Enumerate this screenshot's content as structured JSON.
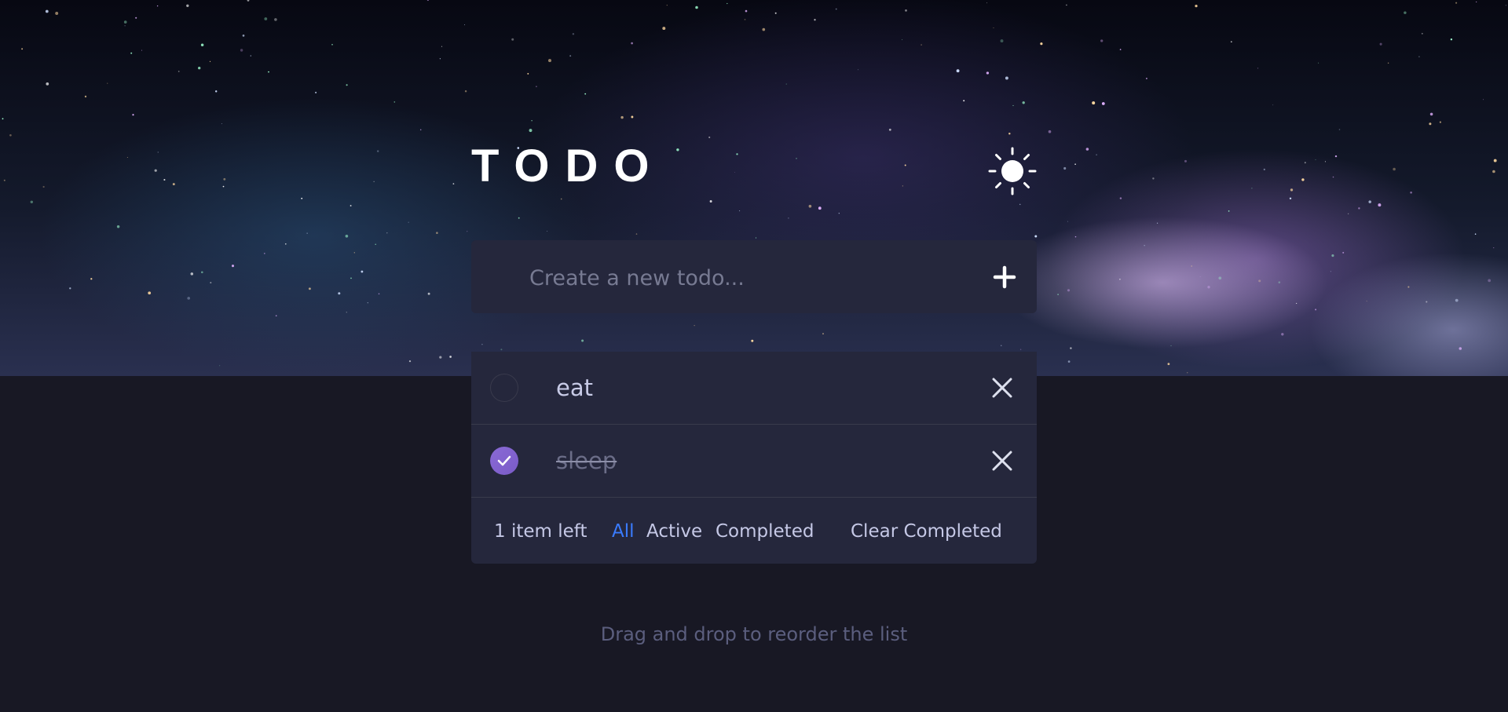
{
  "app": {
    "title": "TODO",
    "theme_toggle_icon": "sun-icon"
  },
  "new_todo": {
    "placeholder": "Create a new todo...",
    "value": "",
    "add_icon": "plus-icon"
  },
  "todos": [
    {
      "text": "eat",
      "completed": false
    },
    {
      "text": "sleep",
      "completed": true
    }
  ],
  "footer": {
    "items_left": "1 item left",
    "filters": [
      {
        "label": "All",
        "active": true
      },
      {
        "label": "Active",
        "active": false
      },
      {
        "label": "Completed",
        "active": false
      }
    ],
    "clear_completed": "Clear Completed"
  },
  "hint": "Drag and drop to reorder the list",
  "colors": {
    "page_bg": "#181824",
    "card_bg": "#25273c",
    "accent_blue": "#3a7bfd",
    "check_purple": "#7a5bc7"
  }
}
